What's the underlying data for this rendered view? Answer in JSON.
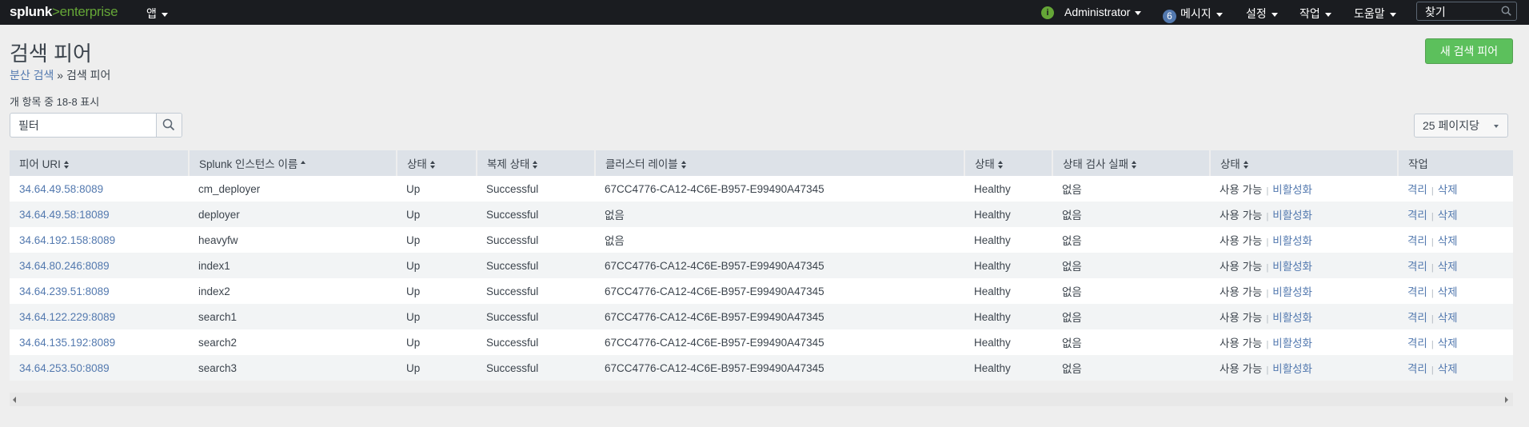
{
  "topbar": {
    "logo_main": "splunk",
    "logo_gt": ">",
    "logo_sub": "enterprise",
    "app_menu": "앱",
    "info_icon": "i",
    "user": "Administrator",
    "messages_count": "6",
    "messages": "메시지",
    "settings": "설정",
    "activity": "작업",
    "help": "도움말",
    "search_placeholder": "찾기"
  },
  "page": {
    "title": "검색 피어",
    "breadcrumb_parent": "분산 검색",
    "breadcrumb_sep": " » ",
    "breadcrumb_current": "검색 피어",
    "new_button": "새 검색 피어",
    "count_text": "개 항목 중 18-8 표시",
    "filter_placeholder": "필터",
    "per_page": "25 페이지당"
  },
  "table": {
    "headers": [
      "피어 URI",
      "Splunk 인스턴스 이름",
      "상태",
      "복제 상태",
      "클러스터 레이블",
      "상태",
      "상태 검사 실패",
      "상태",
      "작업"
    ],
    "rows": [
      {
        "uri": "34.64.49.58:8089",
        "name": "cm_deployer",
        "status": "Up",
        "replication": "Successful",
        "label": "67CC4776-CA12-4C6E-B957-E99490A47345",
        "health": "Healthy",
        "failures": "없음",
        "enable": "사용 가능",
        "disable": "비활성화",
        "quarantine": "격리",
        "delete": "삭제"
      },
      {
        "uri": "34.64.49.58:18089",
        "name": "deployer",
        "status": "Up",
        "replication": "Successful",
        "label": "없음",
        "health": "Healthy",
        "failures": "없음",
        "enable": "사용 가능",
        "disable": "비활성화",
        "quarantine": "격리",
        "delete": "삭제"
      },
      {
        "uri": "34.64.192.158:8089",
        "name": "heavyfw",
        "status": "Up",
        "replication": "Successful",
        "label": "없음",
        "health": "Healthy",
        "failures": "없음",
        "enable": "사용 가능",
        "disable": "비활성화",
        "quarantine": "격리",
        "delete": "삭제"
      },
      {
        "uri": "34.64.80.246:8089",
        "name": "index1",
        "status": "Up",
        "replication": "Successful",
        "label": "67CC4776-CA12-4C6E-B957-E99490A47345",
        "health": "Healthy",
        "failures": "없음",
        "enable": "사용 가능",
        "disable": "비활성화",
        "quarantine": "격리",
        "delete": "삭제"
      },
      {
        "uri": "34.64.239.51:8089",
        "name": "index2",
        "status": "Up",
        "replication": "Successful",
        "label": "67CC4776-CA12-4C6E-B957-E99490A47345",
        "health": "Healthy",
        "failures": "없음",
        "enable": "사용 가능",
        "disable": "비활성화",
        "quarantine": "격리",
        "delete": "삭제"
      },
      {
        "uri": "34.64.122.229:8089",
        "name": "search1",
        "status": "Up",
        "replication": "Successful",
        "label": "67CC4776-CA12-4C6E-B957-E99490A47345",
        "health": "Healthy",
        "failures": "없음",
        "enable": "사용 가능",
        "disable": "비활성화",
        "quarantine": "격리",
        "delete": "삭제"
      },
      {
        "uri": "34.64.135.192:8089",
        "name": "search2",
        "status": "Up",
        "replication": "Successful",
        "label": "67CC4776-CA12-4C6E-B957-E99490A47345",
        "health": "Healthy",
        "failures": "없음",
        "enable": "사용 가능",
        "disable": "비활성화",
        "quarantine": "격리",
        "delete": "삭제"
      },
      {
        "uri": "34.64.253.50:8089",
        "name": "search3",
        "status": "Up",
        "replication": "Successful",
        "label": "67CC4776-CA12-4C6E-B957-E99490A47345",
        "health": "Healthy",
        "failures": "없음",
        "enable": "사용 가능",
        "disable": "비활성화",
        "quarantine": "격리",
        "delete": "삭제"
      }
    ]
  },
  "colors": {
    "topbar_bg": "#1a1c20",
    "brand_green": "#65a637",
    "link_blue": "#5379af",
    "primary_button": "#5cc05c"
  }
}
